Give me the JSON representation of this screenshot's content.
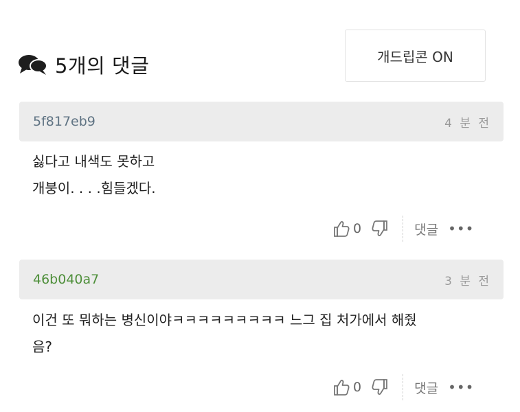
{
  "header": {
    "title": "5개의 댓글",
    "gif_toggle_label": "개드립콘 ON"
  },
  "comments": [
    {
      "author": "5f817eb9",
      "time": "4 분 전",
      "lines": [
        "싫다고 내색도 못하고",
        "개붕이. . . .힘들겠다."
      ],
      "likes": "0",
      "reply_label": "댓글",
      "more_label": "•••"
    },
    {
      "author": "46b040a7",
      "time": "3 분 전",
      "lines": [
        "이건 또 뭐하는 병신이야ㅋㅋㅋㅋㅋㅋㅋㅋㅋ 느그 집 처가에서 해줬",
        "음?"
      ],
      "likes": "0",
      "reply_label": "댓글",
      "more_label": "•••"
    }
  ],
  "colors": {
    "author_1": "#5f7383",
    "author_2": "#4e8f3a",
    "comment_header_bg": "#ececec"
  }
}
